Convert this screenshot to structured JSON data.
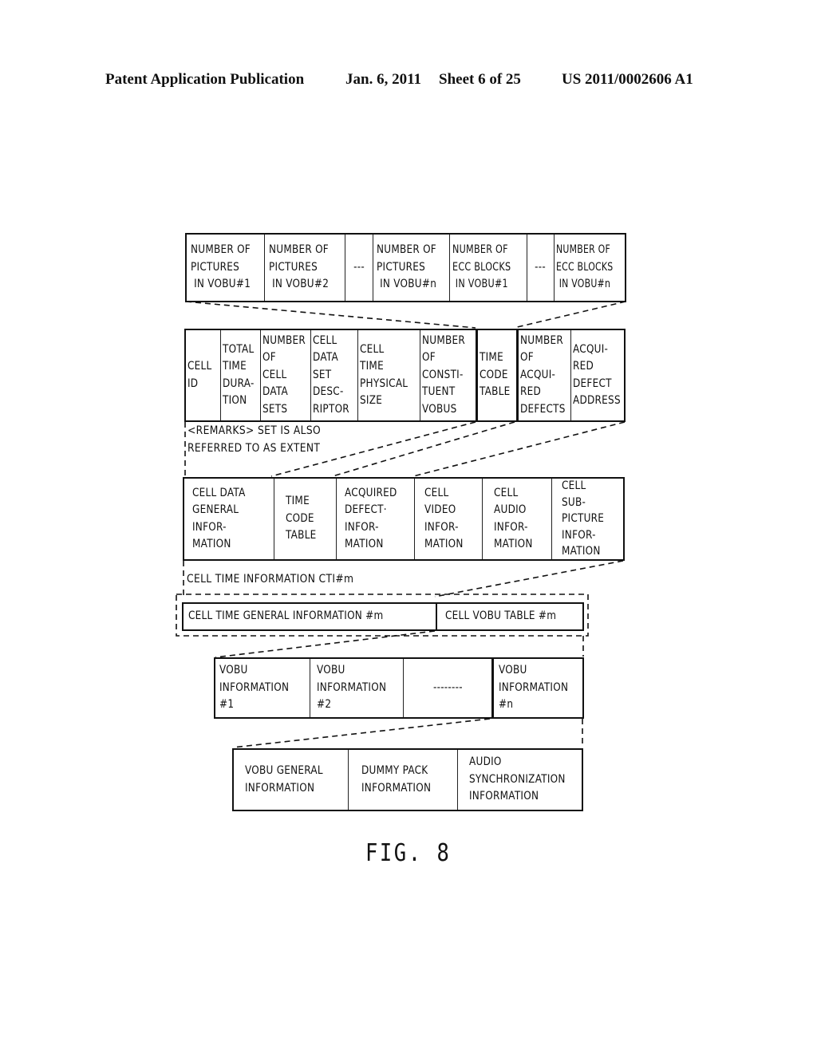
{
  "header": {
    "publication": "Patent Application Publication",
    "date": "Jan. 6, 2011",
    "sheet": "Sheet 6 of 25",
    "number": "US 2011/0002606 A1"
  },
  "row_vobu_counts": {
    "cells": [
      "NUMBER OF\nPICTURES\n IN VOBU#1",
      "NUMBER OF\nPICTURES\n IN VOBU#2",
      "---",
      "NUMBER OF\nPICTURES\n IN VOBU#n",
      "NUMBER OF\nECC BLOCKS\n IN VOBU#1",
      "---",
      "NUMBER OF\nECC BLOCKS\n IN VOBU#n"
    ]
  },
  "row_cell_data_general": {
    "cells": [
      "CELL\nID",
      "TOTAL\nTIME\nDURA-\nTION",
      "NUMBER\nOF\nCELL\nDATA\nSETS",
      "CELL\nDATA\nSET\nDESC-\nRIPTOR",
      "CELL\nTIME\nPHYSICAL\nSIZE",
      "NUMBER\nOF\nCONSTI-\nTUENT\nVOBUS",
      "TIME\nCODE\nTABLE",
      "NUMBER\nOF\nACQUI-\nRED\nDEFECTS",
      "ACQUI-\nRED\nDEFECT\nADDRESS"
    ],
    "remark": "<REMARKS> SET IS ALSO\nREFERRED TO AS EXTENT"
  },
  "row_cell_time_information": {
    "cells": [
      "CELL DATA\nGENERAL\nINFOR-\nMATION",
      "TIME\nCODE\nTABLE",
      "ACQUIRED\nDEFECT·\nINFOR-\nMATION",
      "CELL\nVIDEO\nINFOR-\nMATION",
      "CELL\nAUDIO\nINFOR-\nMATION",
      "CELL\nSUB-\nPICTURE\nINFOR-\nMATION"
    ],
    "label": "CELL TIME INFORMATION CTI#m"
  },
  "row_cti_m": {
    "cells": [
      "CELL TIME GENERAL INFORMATION #m",
      "CELL VOBU TABLE #m"
    ]
  },
  "row_vobu_table": {
    "cells": [
      "VOBU\nINFORMATION\n#1",
      "VOBU\nINFORMATION\n#2",
      "--------",
      "VOBU\nINFORMATION\n#n"
    ]
  },
  "row_vobu_information": {
    "cells": [
      "VOBU GENERAL\nINFORMATION",
      "DUMMY PACK\nINFORMATION",
      "AUDIO\nSYNCHRONIZATION\nINFORMATION"
    ]
  },
  "figure_label": "FIG. 8"
}
